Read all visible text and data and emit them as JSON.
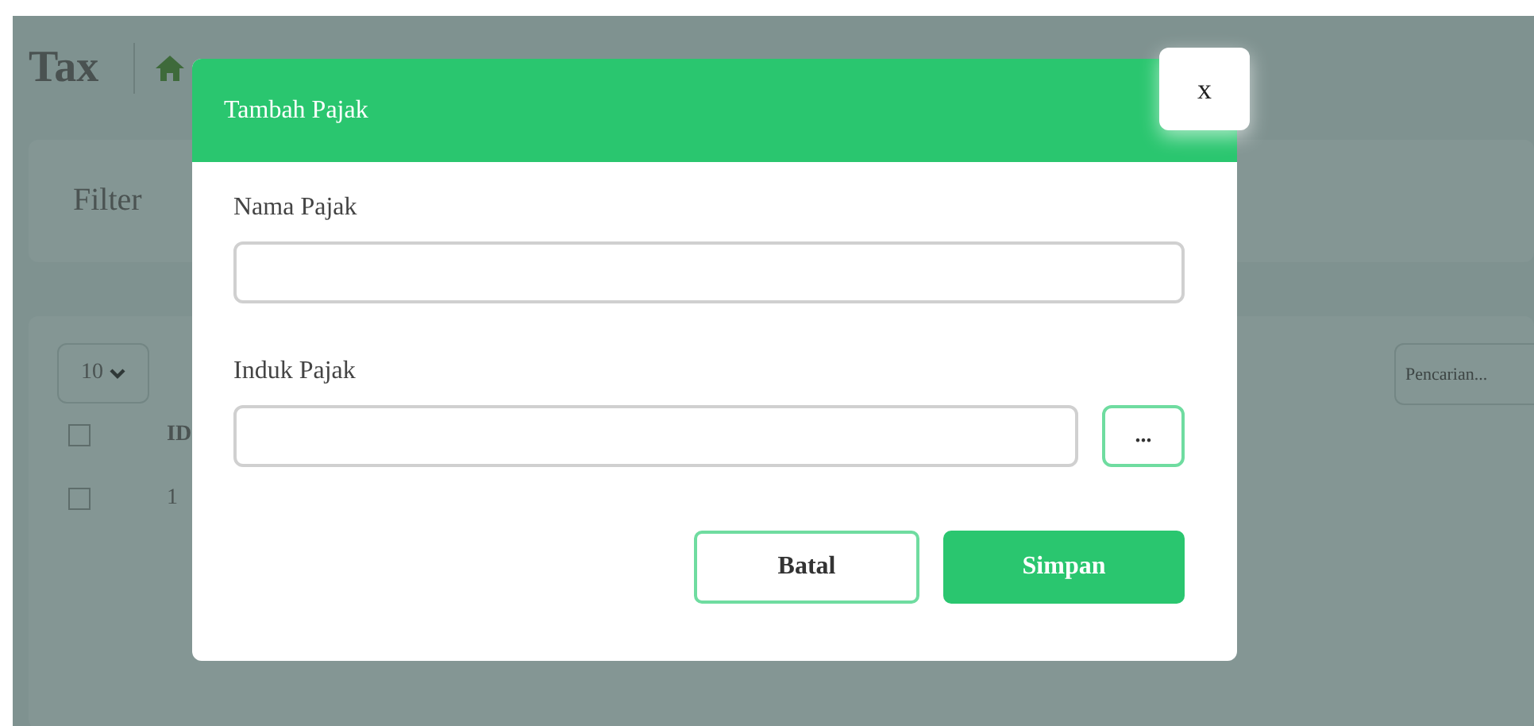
{
  "page": {
    "title": "Tax",
    "filter": {
      "label": "Filter"
    },
    "table": {
      "page_size": "10",
      "search": {
        "placeholder": "Pencarian..."
      },
      "columns": [
        {
          "label": "ID"
        }
      ],
      "header_checked": false,
      "rows": [
        {
          "cells": [
            "1"
          ],
          "checked": false
        }
      ]
    }
  },
  "dialog": {
    "title": "Tambah Pajak",
    "close": "x",
    "fields": [
      {
        "kind": "text",
        "label": "Nama Pajak"
      },
      {
        "kind": "lookup",
        "label": "Induk Pajak",
        "button": "..."
      }
    ],
    "buttons": [
      {
        "kind": "secondary",
        "label": "Batal"
      },
      {
        "kind": "primary",
        "label": "Simpan"
      }
    ]
  }
}
